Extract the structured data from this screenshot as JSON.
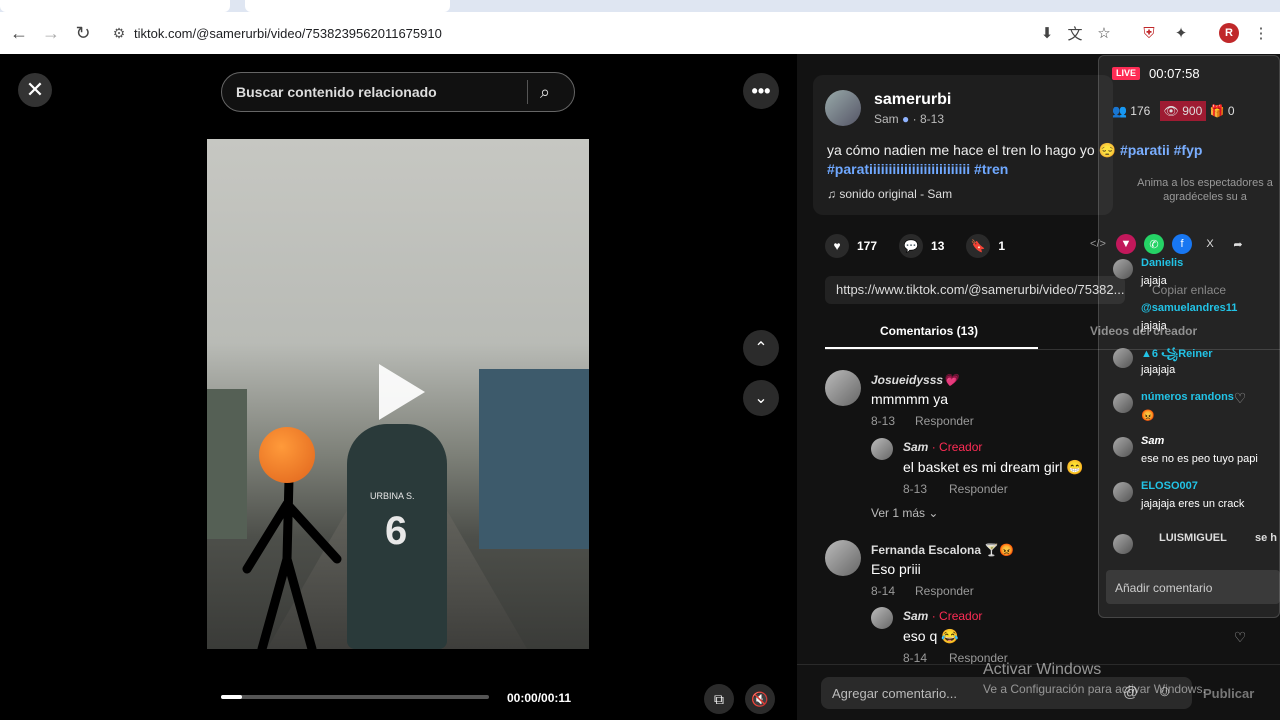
{
  "browser": {
    "url": "tiktok.com/@samerurbi/video/7538239562011675910",
    "profile_initial": "R"
  },
  "video": {
    "search_placeholder": "Buscar contenido relacionado",
    "time": "00:00/00:11",
    "progress": 0.08,
    "jersey_name": "URBINA S.",
    "jersey_number": "6"
  },
  "post": {
    "author": "samerurbi",
    "author_display": "Sam",
    "date": "8-13",
    "caption_text": "ya cómo nadien me hace el tren lo hago yo 😔 ",
    "caption_tags_1": "#paratii #fyp",
    "caption_tags_2": "#paratiiiiiiiiiiiiiiiiiiiiiiiiii #tren",
    "sound": "sonido original - Sam",
    "likes": "177",
    "comments": "13",
    "saves": "1",
    "link": "https://www.tiktok.com/@samerurbi/video/75382..."
  },
  "tabs": {
    "comments": "Comentarios (13)",
    "creator_videos": "Videos del creador"
  },
  "comments": [
    {
      "name": "Josueidysss💗",
      "text": "mmmmm ya",
      "date": "8-13",
      "reply": "Responder"
    },
    {
      "name": "Sam",
      "creator": "· Creador",
      "text": "el basket es mi dream girl 😁",
      "date": "8-13",
      "reply": "Responder"
    },
    {
      "more": "Ver 1 más"
    },
    {
      "name": "Fernanda Escalona 🍸😡",
      "text": "Eso priii",
      "date": "8-14",
      "reply": "Responder"
    },
    {
      "name": "Sam",
      "creator": "· Creador",
      "text": "eso q 😂",
      "date": "8-14",
      "reply": "Responder"
    }
  ],
  "add_comment": {
    "placeholder": "Agregar comentario...",
    "publish": "Publicar"
  },
  "live": {
    "badge": "LIVE",
    "time": "00:07:58",
    "people": "176",
    "viewers": "900",
    "gifts": "0",
    "hint": "Anima a los espectadores a agradéceles su a",
    "messages": [
      {
        "name": "Danielis",
        "text": "jajaja"
      },
      {
        "name": "@samuelandres11",
        "text": "jajaja"
      },
      {
        "name": "▲6 ꧁Reiner",
        "text": "jajajaja"
      },
      {
        "name": "números randons",
        "text": "😡"
      },
      {
        "name": "Sam",
        "text": "ese no es peo tuyo papi"
      },
      {
        "name": "ELOSO007",
        "text": "jajajaja eres un crack"
      },
      {
        "name": "LUISMIGUEL",
        "text": "se h"
      }
    ],
    "input_placeholder": "Añadir comentario",
    "copy_link": "Copiar enlace"
  },
  "watermark": {
    "line1": "Activar Windows",
    "line2": "Ve a Configuración para activar Windows."
  }
}
